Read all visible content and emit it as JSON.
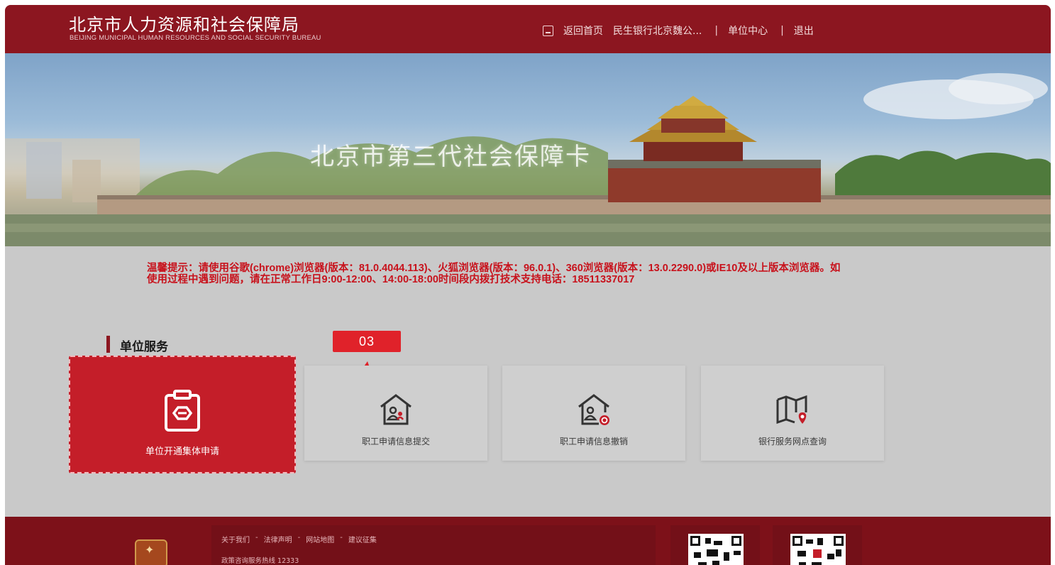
{
  "header": {
    "title_cn": "北京市人力资源和社会保障局",
    "title_en": "BEIJING MUNICIPAL HUMAN RESOURCES AND SOCIAL SECURITY BUREAU",
    "nav": {
      "home": "返回首页",
      "bank": "民生银行北京魏公...",
      "separator": "|",
      "unit_center": "单位中心",
      "logout": "退出"
    }
  },
  "banner": {
    "title": "北京市第三代社会保障卡"
  },
  "notice": {
    "text": "温馨提示：请使用谷歌(chrome)浏览器(版本：81.0.4044.113)、火狐浏览器(版本：96.0.1)、360浏览器(版本：13.0.2290.0)或IE10及以上版本浏览器。如使用过程中遇到问题，请在正常工作日9:00-12:00、14:00-18:00时间段内拨打技术支持电话：18511337017"
  },
  "section": {
    "title": "单位服务"
  },
  "step_badge": "03",
  "services": [
    {
      "label": "单位开通集体申请",
      "icon": "clipboard-icon",
      "active": true
    },
    {
      "label": "职工申请信息提交",
      "icon": "house-person-icon",
      "active": false
    },
    {
      "label": "职工申请信息撤销",
      "icon": "house-person-cancel-icon",
      "active": false
    },
    {
      "label": "银行服务网点查询",
      "icon": "map-location-icon",
      "active": false
    }
  ],
  "footer": {
    "links": [
      "关于我们",
      "-",
      "法律声明",
      "-",
      "网站地图",
      "-",
      "建议征集"
    ],
    "hotline": "政策咨询服务热线 12333",
    "emblem_icon": "emblem-icon"
  },
  "colors": {
    "brand_red": "#8c1620",
    "accent_red": "#c41e29",
    "notice_red": "#c8121c"
  }
}
